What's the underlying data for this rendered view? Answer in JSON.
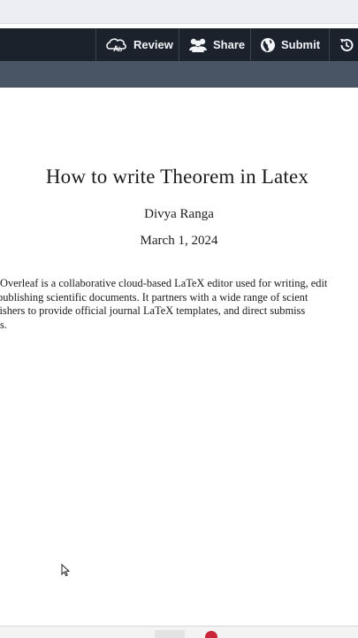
{
  "toolbar": {
    "review_label": "Review",
    "share_label": "Share",
    "submit_label": "Submit",
    "icons": {
      "review": "review-icon",
      "share": "share-icon",
      "submit": "globe-icon",
      "history": "history-icon"
    }
  },
  "document": {
    "title": "How to write Theorem in Latex",
    "author": "Divya Ranga",
    "date": "March 1, 2024",
    "paragraph_lines": [
      "Overleaf is a collaborative cloud-based LaTeX editor used for writing, edit",
      "publishing scientific documents. It partners with a wide range of scient",
      "lishers to provide official journal LaTeX templates, and direct submiss",
      "s."
    ]
  },
  "colors": {
    "toolbar_bg": "#1b222c",
    "subbar_bg": "#495565",
    "taskbar_accent": "#c8283a"
  }
}
